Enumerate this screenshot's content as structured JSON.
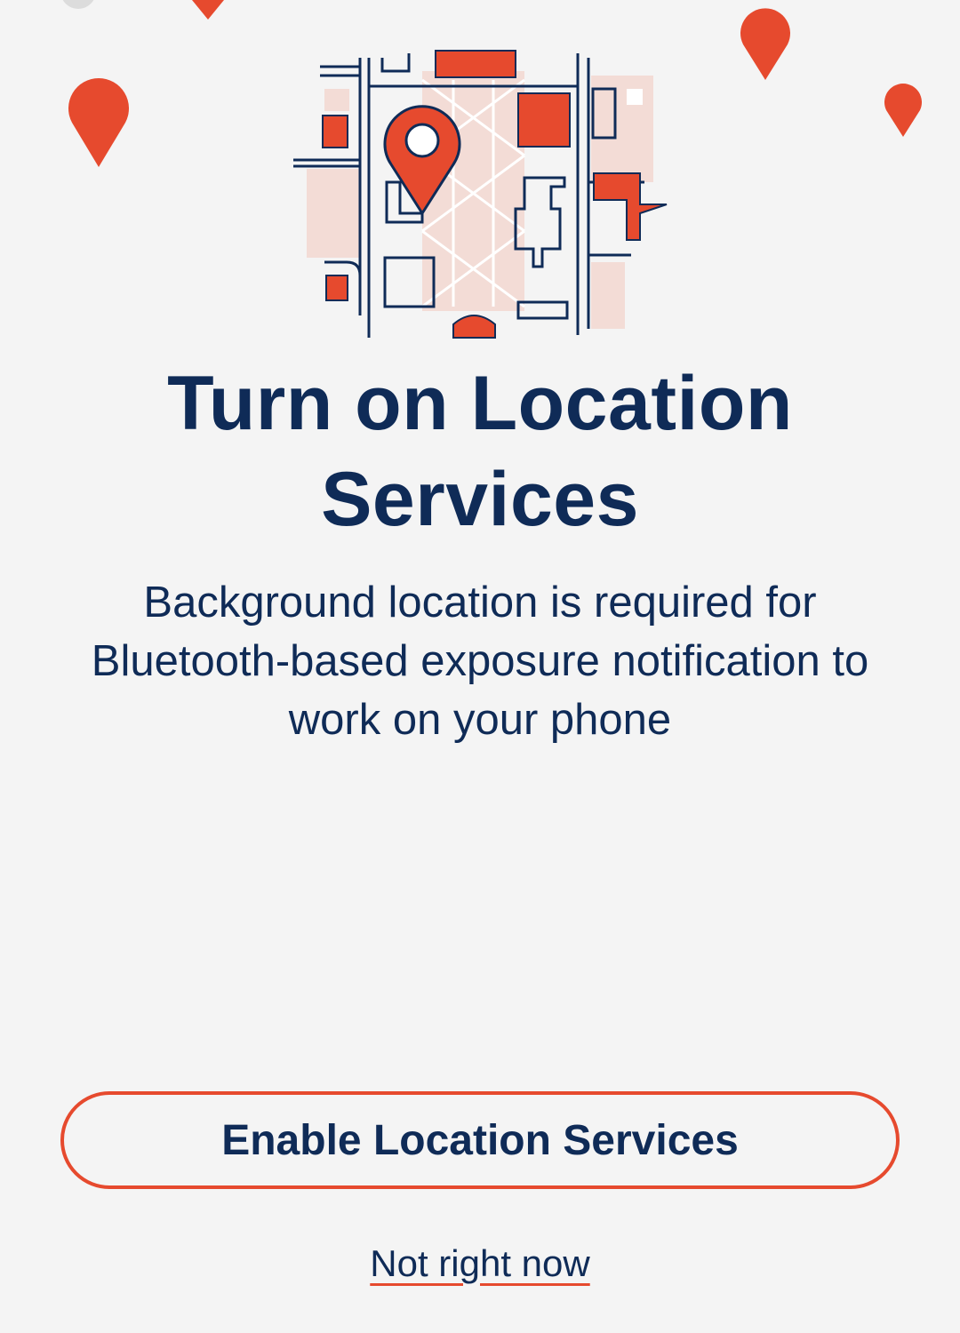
{
  "theme": {
    "background": "#f4f4f4",
    "accent": "#e64a2e",
    "text": "#0f2b57",
    "map_tint": "#f3dcd6"
  },
  "illustration": {
    "icon": "map-with-location-pin-icon",
    "decorative_pins": "location-pin-icon"
  },
  "screen": {
    "title": "Turn on Location Services",
    "description": "Background location is required for Bluetooth-based exposure notification to work on your phone"
  },
  "actions": {
    "enable_label": "Enable Location Services",
    "skip_label": "Not right now"
  }
}
